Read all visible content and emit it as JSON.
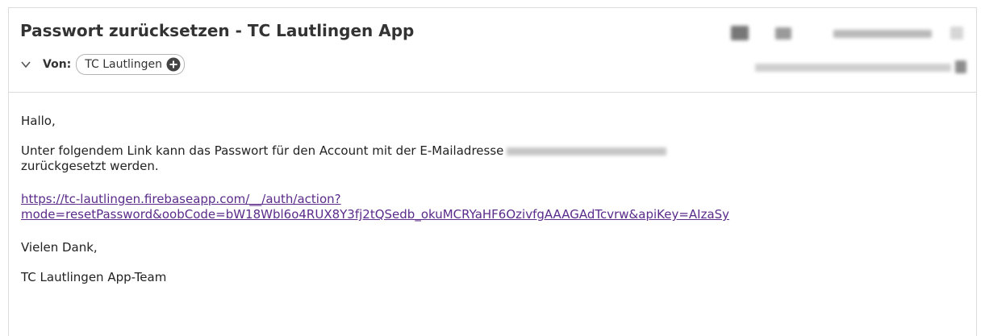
{
  "email": {
    "subject": "Passwort zurücksetzen - TC Lautlingen App",
    "from_label": "Von:",
    "sender_name": "TC Lautlingen"
  },
  "toolbar": {
    "icons": [
      "reply-icon",
      "forward-icon",
      "more-actions-icon",
      "star-icon"
    ]
  },
  "body": {
    "greeting": "Hallo,",
    "line1": "Unter folgendem Link kann das Passwort für den Account mit der E-Mailadresse",
    "line2": "zurückgesetzt werden.",
    "link_line1": "https://tc-lautlingen.firebaseapp.com/__/auth/action?",
    "link_line2": "mode=resetPassword&oobCode=bW18Wbl6o4RUX8Y3fj2tQSedb_okuMCRYaHF6OzivfgAAAGAdTcvrw&apiKey=AIzaSy",
    "thanks": "Vielen Dank,",
    "signature": "TC Lautlingen App-Team"
  },
  "colors": {
    "link": "#5a2b8a",
    "border": "#dcdcdc",
    "text": "#222222"
  }
}
